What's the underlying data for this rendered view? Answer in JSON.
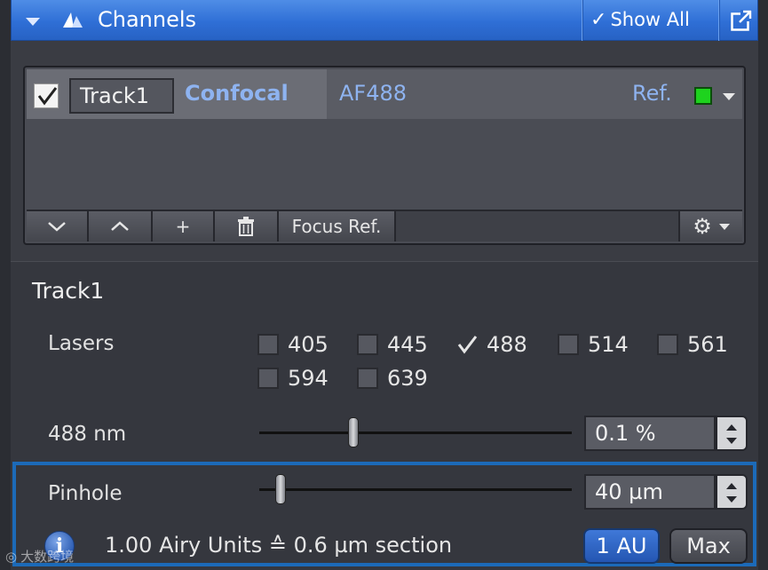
{
  "header": {
    "title": "Channels",
    "show_all_label": "Show All",
    "icons": [
      "chevron-down-icon",
      "channels-logo-icon",
      "check-icon",
      "popout-icon"
    ],
    "accent_color": "#2f6fd6"
  },
  "track_list": {
    "tracks": [
      {
        "checked": true,
        "name": "Track1",
        "type": "Confocal",
        "dye": "AF488",
        "ref_label": "Ref.",
        "color": "#1ed31e"
      }
    ],
    "toolbar": {
      "move_down_icon": "chevron-down-icon",
      "move_up_icon": "chevron-up-icon",
      "add_label": "+",
      "delete_icon": "trash-icon",
      "focus_ref_label": "Focus Ref.",
      "settings_icon": "gear-icon"
    }
  },
  "settings": {
    "title": "Track1",
    "lasers_label": "Lasers",
    "lasers": [
      {
        "wavelength": "405",
        "checked": false
      },
      {
        "wavelength": "445",
        "checked": false
      },
      {
        "wavelength": "488",
        "checked": true
      },
      {
        "wavelength": "514",
        "checked": false
      },
      {
        "wavelength": "561",
        "checked": false
      },
      {
        "wavelength": "594",
        "checked": false
      },
      {
        "wavelength": "639",
        "checked": false
      }
    ],
    "power": {
      "label": "488 nm",
      "value": "0.1 %"
    },
    "pinhole": {
      "label": "Pinhole",
      "value": "40 µm",
      "info_text": "1.00 Airy Units ≙ 0.6 µm section",
      "btn_au": "1 AU",
      "btn_max": "Max"
    }
  },
  "watermark": "大数跨境"
}
